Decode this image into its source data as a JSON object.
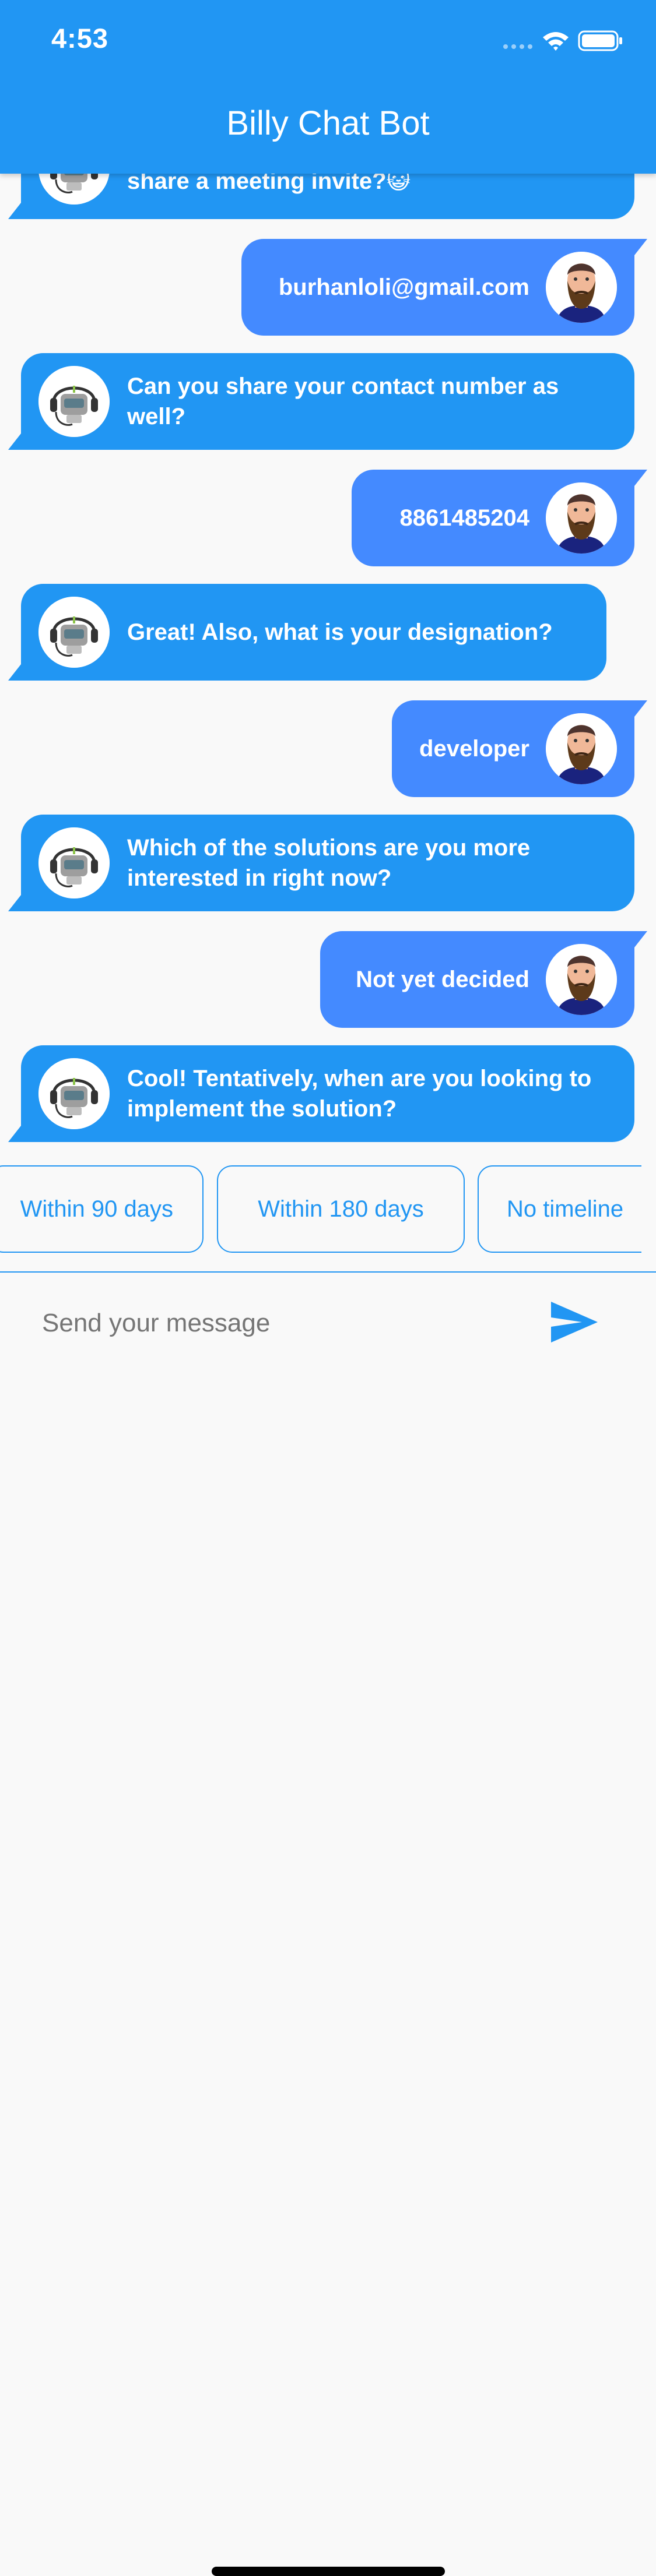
{
  "status_bar": {
    "time": "4:53"
  },
  "app_bar": {
    "title": "Billy Chat Bot"
  },
  "messages": [
    {
      "sender": "bot",
      "text": "share a meeting invite?😺"
    },
    {
      "sender": "user",
      "text": "burhanloli@gmail.com"
    },
    {
      "sender": "bot",
      "text": "Can you share your contact number as well?"
    },
    {
      "sender": "user",
      "text": "8861485204"
    },
    {
      "sender": "bot",
      "text": "Great! Also, what is your designation?"
    },
    {
      "sender": "user",
      "text": "developer"
    },
    {
      "sender": "bot",
      "text": "Which of the solutions are you more interested in right now?"
    },
    {
      "sender": "user",
      "text": "Not yet decided"
    },
    {
      "sender": "bot",
      "text": "Cool! Tentatively, when are you looking to implement the solution?"
    }
  ],
  "quick_replies": [
    "Within 90 days",
    "Within 180 days",
    "No timeline"
  ],
  "composer": {
    "placeholder": "Send your message"
  },
  "colors": {
    "primary": "#2196f3",
    "user_bubble": "#448aff",
    "background": "#f9f9f9"
  },
  "icons": {
    "send": "send-icon",
    "bot_avatar": "robot-headset-icon",
    "user_avatar": "bearded-man-icon"
  }
}
